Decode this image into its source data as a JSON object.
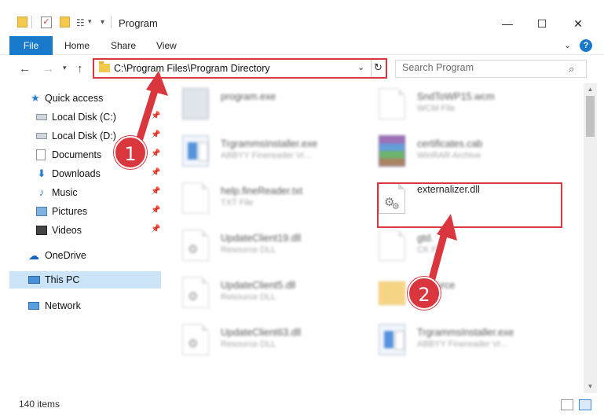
{
  "window": {
    "title": "Program",
    "minimize_glyph": "—",
    "maximize_glyph": "☐",
    "close_glyph": "✕"
  },
  "ribbon": {
    "file": "File",
    "home": "Home",
    "share": "Share",
    "view": "View",
    "help": "?"
  },
  "nav": {
    "address": "C:\\Program Files\\Program Directory",
    "search_placeholder": "Search Program"
  },
  "sidebar": {
    "items": [
      {
        "label": "Quick access",
        "icon": "star-icon",
        "pinned": false
      },
      {
        "label": "Local Disk (C:)",
        "icon": "drive-icon",
        "pinned": true
      },
      {
        "label": "Local Disk (D:)",
        "icon": "drive-icon",
        "pinned": true
      },
      {
        "label": "Documents",
        "icon": "documents-icon",
        "pinned": true
      },
      {
        "label": "Downloads",
        "icon": "download-icon",
        "pinned": true
      },
      {
        "label": "Music",
        "icon": "music-icon",
        "pinned": true
      },
      {
        "label": "Pictures",
        "icon": "pictures-icon",
        "pinned": true
      },
      {
        "label": "Videos",
        "icon": "videos-icon",
        "pinned": true
      },
      {
        "label": "OneDrive",
        "icon": "cloud-icon",
        "pinned": false
      },
      {
        "label": "This PC",
        "icon": "computer-icon",
        "pinned": false,
        "selected": true
      },
      {
        "label": "Network",
        "icon": "network-icon",
        "pinned": false
      }
    ]
  },
  "files": [
    {
      "name": "program.exe",
      "type": "",
      "icon": "setup-icon",
      "blurred": true
    },
    {
      "name": "SndToWP15.wcm",
      "type": "WCM File",
      "icon": "document-icon",
      "blurred": true
    },
    {
      "name": "TrgrammsInstaller.exe",
      "type": "ABBYY Finereader Vr...",
      "icon": "exe-icon",
      "blurred": true
    },
    {
      "name": "certificates.cab",
      "type": "WinRAR Archive",
      "icon": "rar-icon",
      "blurred": true
    },
    {
      "name": "help.fineReader.txt",
      "type": "TXT File",
      "icon": "document-icon",
      "blurred": true
    },
    {
      "name": "externalizer.dll",
      "type": "",
      "icon": "gear-document-icon",
      "blurred": false
    },
    {
      "name": "UpdateClient19.dll",
      "type": "Resource DLL",
      "icon": "gear-document-icon",
      "blurred": true
    },
    {
      "name": "gtd.",
      "type": "CK Fi",
      "icon": "document-icon",
      "blurred": true
    },
    {
      "name": "UpdateClient5.dll",
      "type": "Resource DLL",
      "icon": "gear-document-icon",
      "blurred": true
    },
    {
      "name": "urce",
      "type": "",
      "icon": "folder-icon",
      "blurred": true
    },
    {
      "name": "UpdateClient63.dll",
      "type": "Resource DLL",
      "icon": "gear-document-icon",
      "blurred": true
    },
    {
      "name": "TrgrammsInstaller.exe",
      "type": "ABBYY Finereader Vr...",
      "icon": "exe-icon",
      "blurred": true
    }
  ],
  "status": {
    "item_count": "140 items"
  },
  "steps": {
    "one": "1",
    "two": "2"
  },
  "colors": {
    "accent": "#1979ca",
    "highlight": "#d9363e",
    "selection": "#cce4f7"
  }
}
